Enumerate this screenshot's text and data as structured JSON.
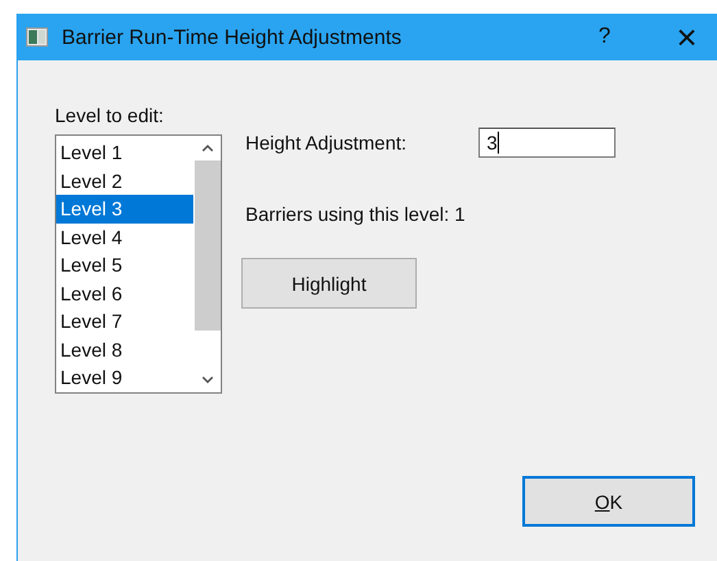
{
  "window": {
    "title": "Barrier Run-Time Height Adjustments",
    "help_button": "?",
    "close_button": "×"
  },
  "level_list": {
    "label": "Level to edit:",
    "items": [
      {
        "label": "Level 1",
        "selected": false
      },
      {
        "label": "Level 2",
        "selected": false
      },
      {
        "label": "Level 3",
        "selected": true
      },
      {
        "label": "Level 4",
        "selected": false
      },
      {
        "label": "Level 5",
        "selected": false
      },
      {
        "label": "Level 6",
        "selected": false
      },
      {
        "label": "Level 7",
        "selected": false
      },
      {
        "label": "Level 8",
        "selected": false
      },
      {
        "label": "Level 9",
        "selected": false
      }
    ]
  },
  "height_adjustment": {
    "label": "Height Adjustment:",
    "value": "3"
  },
  "barriers_info": "Barriers using this level: 1",
  "buttons": [
    {
      "label": "Highlight",
      "kind": "secondary",
      "focused": false,
      "mnemonic_first": false
    },
    {
      "label": "OK",
      "kind": "primary",
      "focused": true,
      "mnemonic_first": true
    }
  ]
}
